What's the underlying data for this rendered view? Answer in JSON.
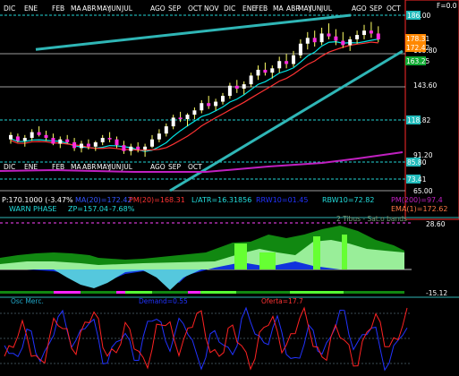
{
  "colors": {
    "background": "#000000",
    "grid": "#ffffff",
    "price_axis_border": "#ff2a2a",
    "channel": "#2fb6b6",
    "cyan_level": "#22d4d4",
    "up_candle": "#ffffff",
    "down_candle": "#ff2de0",
    "candle_wick": "#ffff66",
    "ma_cyan": "#00e5e5",
    "ma_red": "#ff3333",
    "pm_purple": "#c020c0",
    "green_dark": "#118811",
    "green_light": "#99ee99",
    "green_lime": "#66ff33",
    "blue_fill": "#1133dd",
    "cyan_fill": "#55c8dd",
    "osc_blue": "#2233ff",
    "osc_red": "#ff2222",
    "label_yellow": "#ffff00"
  },
  "header": {
    "axis_top_label": "F=0.0"
  },
  "months_row1": [
    "DIC",
    "ENE",
    "FEB",
    "MA",
    "ABR",
    "MAY",
    "JUN",
    "JUL",
    "AGO",
    "SEP",
    "OCT",
    "NOV",
    "DIC",
    "ENE",
    "FEB",
    "MA",
    "ABR",
    "MAY",
    "JUN",
    "JUL",
    "AGO",
    "SEP",
    "OCT"
  ],
  "months_row2": [
    "DIC",
    "ENE",
    "FEB",
    "MA",
    "ABR",
    "MAY",
    "JUN",
    "JUL",
    "AGO",
    "SEP",
    "OCT"
  ],
  "price_axis": {
    "ticks": [
      "186.00",
      "169.80",
      "143.60",
      "91.20",
      "65.00"
    ],
    "boxes": {
      "level_1": "186.00",
      "level_2": "118.82",
      "level_3": "85.80",
      "level_4": "73.41",
      "last_1": "178.31",
      "last_2": "172.42",
      "last_3": "163.25"
    }
  },
  "info_line_1": {
    "p": "P:170.1000 (-3.47%",
    "ma": "MA(20)=172.42",
    "pm": "PM(20)=168.31",
    "latr": "L/ATR=16.31856",
    "rrw": "RRW10=01.45",
    "rbw": "RBW10=72.82",
    "pm200": "PM(200)=97.4"
  },
  "info_line_2": {
    "warn": "WARN PHASE",
    "zp": "ZP=157.04",
    "pct": "-7.68%",
    "ema": "EMA(1)=172.62"
  },
  "middle_panel": {
    "title": "2 Tibus - Sat.o bands",
    "ticks": [
      "28.60",
      "-15.12"
    ]
  },
  "osc_panel": {
    "label_left": "Osc Merc.",
    "label_mid": "Demand=0.55",
    "label_right": "Oferta=17.7"
  },
  "chart_data": {
    "type": "candlestick",
    "ylim": [
      65,
      186
    ],
    "channel_upper": [
      [
        0,
        165.5
      ],
      [
        62,
        186
      ]
    ],
    "channel_lower": [
      [
        0,
        67
      ],
      [
        62,
        171
      ]
    ],
    "candles": [
      [
        101,
        106,
        98,
        104
      ],
      [
        103,
        105,
        99,
        100
      ],
      [
        100,
        104,
        96,
        102
      ],
      [
        102,
        108,
        100,
        106
      ],
      [
        106,
        110,
        103,
        104
      ],
      [
        104,
        107,
        100,
        102
      ],
      [
        102,
        105,
        97,
        98
      ],
      [
        98,
        103,
        95,
        101
      ],
      [
        101,
        104,
        98,
        99
      ],
      [
        99,
        102,
        93,
        95
      ],
      [
        95,
        100,
        92,
        98
      ],
      [
        98,
        101,
        94,
        96
      ],
      [
        96,
        100,
        93,
        99
      ],
      [
        99,
        104,
        97,
        102
      ],
      [
        102,
        106,
        99,
        101
      ],
      [
        101,
        103,
        95,
        97
      ],
      [
        97,
        100,
        91,
        93
      ],
      [
        93,
        98,
        90,
        96
      ],
      [
        96,
        99,
        92,
        94
      ],
      [
        94,
        98,
        89,
        96
      ],
      [
        96,
        104,
        95,
        101
      ],
      [
        101,
        108,
        99,
        105
      ],
      [
        105,
        112,
        103,
        110
      ],
      [
        110,
        118,
        108,
        116
      ],
      [
        116,
        120,
        113,
        115
      ],
      [
        115,
        119,
        110,
        118
      ],
      [
        118,
        123,
        115,
        121
      ],
      [
        121,
        128,
        119,
        126
      ],
      [
        126,
        131,
        122,
        124
      ],
      [
        124,
        129,
        121,
        127
      ],
      [
        127,
        133,
        125,
        131
      ],
      [
        131,
        140,
        129,
        138
      ],
      [
        138,
        142,
        133,
        136
      ],
      [
        136,
        141,
        132,
        139
      ],
      [
        139,
        147,
        137,
        145
      ],
      [
        145,
        152,
        142,
        149
      ],
      [
        149,
        154,
        145,
        147
      ],
      [
        147,
        152,
        143,
        150
      ],
      [
        150,
        158,
        147,
        155
      ],
      [
        155,
        160,
        150,
        153
      ],
      [
        153,
        162,
        151,
        159
      ],
      [
        159,
        170,
        157,
        167
      ],
      [
        167,
        175,
        163,
        171
      ],
      [
        171,
        176,
        165,
        168
      ],
      [
        168,
        178,
        166,
        174
      ],
      [
        174,
        181,
        170,
        172
      ],
      [
        172,
        177,
        166,
        169
      ],
      [
        169,
        175,
        164,
        166
      ],
      [
        166,
        172,
        162,
        170
      ],
      [
        170,
        176,
        167,
        173
      ],
      [
        173,
        180,
        170,
        176
      ],
      [
        176,
        182,
        171,
        174
      ],
      [
        174,
        179,
        168,
        170
      ]
    ]
  }
}
